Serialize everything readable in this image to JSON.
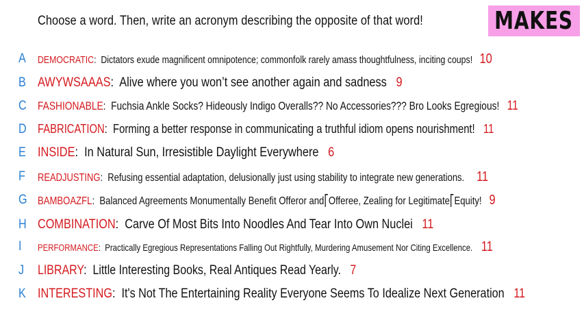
{
  "prompt": "Choose a word. Then, write an acronym describing the opposite of that word!",
  "brand": "MAKES",
  "colors": {
    "letter": "#2a7fd4",
    "word": "#d4191e",
    "score": "#d4191e",
    "brand_bg": "#f7a0e8"
  },
  "entries": [
    {
      "letter": "A",
      "word": "DEMOCRATIC",
      "acronym": "Dictators exude magnificent omnipotence; commonfolk rarely amass thoughtfulness, inciting coups!",
      "score": "10"
    },
    {
      "letter": "B",
      "word": "AWYWSAAAS",
      "acronym": "Alive where you won’t see another again and sadness",
      "score": "9"
    },
    {
      "letter": "C",
      "word": "FASHIONABLE",
      "acronym": "Fuchsia Ankle Socks? Hideously Indigo Overalls?? No Accessories??? Bro Looks Egregious!",
      "score": "11"
    },
    {
      "letter": "D",
      "word": "FABRICATION",
      "acronym": "Forming a better response in communicating a truthful idiom opens nourishment!",
      "score": "11"
    },
    {
      "letter": "E",
      "word": "INSIDE",
      "acronym": "In Natural Sun, Irresistible Daylight Everywhere",
      "score": "6"
    },
    {
      "letter": "F",
      "word": "READJUSTING",
      "acronym": "Refusing essential adaptation, delusionally just using stability to  integrate new generations.",
      "score": "11"
    },
    {
      "letter": "G",
      "word": "BAMBOAZFL",
      "acronym": "Balanced Agreements Monumentally Benefit Offeror and⎡Offeree, Zealing for Legitimate⎡Equity!",
      "score": "9"
    },
    {
      "letter": "H",
      "word": "COMBINATION",
      "acronym": "Carve Of Most Bits Into Noodles And Tear Into Own Nuclei",
      "score": "11"
    },
    {
      "letter": "I",
      "word": "PERFORMANCE",
      "acronym": "Practically Egregious Representations Falling Out Rightfully, Murdering Amusement Nor Citing Excellence.",
      "score": "11"
    },
    {
      "letter": "J",
      "word": "LIBRARY",
      "acronym": "Little Interesting Books, Real Antiques Read Yearly.",
      "score": "7"
    },
    {
      "letter": "K",
      "word": "INTERESTING",
      "acronym": "It's Not The Entertaining Reality Everyone Seems To Idealize Next Generation",
      "score": "11"
    }
  ]
}
